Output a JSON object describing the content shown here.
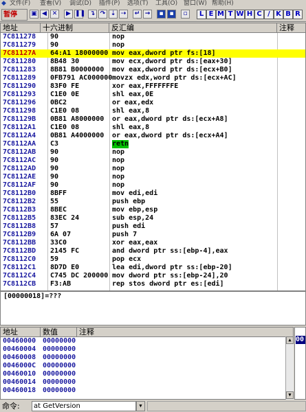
{
  "menu": [
    "文件(F)",
    "查看(V)",
    "调试(D)",
    "插件(P)",
    "选项(T)",
    "工具(O)",
    "窗口(W)",
    "帮助(H)"
  ],
  "status": "暂停",
  "toolbar": {
    "letters": [
      "L",
      "E",
      "M",
      "T",
      "W",
      "H",
      "C",
      "/",
      "K",
      "B",
      "R"
    ]
  },
  "disasm": {
    "headers": {
      "address": "地址",
      "hex": "十六进制",
      "disasm": "反汇编",
      "comment": "注释"
    },
    "rows": [
      {
        "addr": "7C811278",
        "hex": "90",
        "asm": "nop"
      },
      {
        "addr": "7C811279",
        "hex": "90",
        "asm": "nop"
      },
      {
        "addr": "7C81127A",
        "hex": "64:A1 18000000",
        "asm": "mov eax,dword ptr fs:[18]"
      },
      {
        "addr": "7C811280",
        "hex": "8B48 30",
        "asm": "mov ecx,dword ptr ds:[eax+30]"
      },
      {
        "addr": "7C811283",
        "hex": "8B81 B0000000",
        "asm": "mov eax,dword ptr ds:[ecx+B0]"
      },
      {
        "addr": "7C811289",
        "hex": "0FB791 AC000000",
        "asm": "movzx edx,word ptr ds:[ecx+AC]"
      },
      {
        "addr": "7C811290",
        "hex": "83F0 FE",
        "asm": "xor eax,FFFFFFFE"
      },
      {
        "addr": "7C811293",
        "hex": "C1E0 0E",
        "asm": "shl eax,0E"
      },
      {
        "addr": "7C811296",
        "hex": "0BC2",
        "asm": "or eax,edx"
      },
      {
        "addr": "7C811298",
        "hex": "C1E0 08",
        "asm": "shl eax,8"
      },
      {
        "addr": "7C81129B",
        "hex": "0B81 A8000000",
        "asm": "or eax,dword ptr ds:[ecx+A8]"
      },
      {
        "addr": "7C8112A1",
        "hex": "C1E0 08",
        "asm": "shl eax,8"
      },
      {
        "addr": "7C8112A4",
        "hex": "0B81 A4000000",
        "asm": "or eax,dword ptr ds:[ecx+A4]"
      },
      {
        "addr": "7C8112AA",
        "hex": "C3",
        "asm": "retn"
      },
      {
        "addr": "7C8112AB",
        "hex": "90",
        "asm": "nop"
      },
      {
        "addr": "7C8112AC",
        "hex": "90",
        "asm": "nop"
      },
      {
        "addr": "7C8112AD",
        "hex": "90",
        "asm": "nop"
      },
      {
        "addr": "7C8112AE",
        "hex": "90",
        "asm": "nop"
      },
      {
        "addr": "7C8112AF",
        "hex": "90",
        "asm": "nop"
      },
      {
        "addr": "7C8112B0",
        "hex": "8BFF",
        "asm": "mov edi,edi"
      },
      {
        "addr": "7C8112B2",
        "hex": "55",
        "asm": "push ebp"
      },
      {
        "addr": "7C8112B3",
        "hex": "8BEC",
        "asm": "mov ebp,esp"
      },
      {
        "addr": "7C8112B5",
        "hex": "83EC 24",
        "asm": "sub esp,24"
      },
      {
        "addr": "7C8112B8",
        "hex": "57",
        "asm": "push edi"
      },
      {
        "addr": "7C8112B9",
        "hex": "6A 07",
        "asm": "push 7"
      },
      {
        "addr": "7C8112BB",
        "hex": "33C0",
        "asm": "xor eax,eax"
      },
      {
        "addr": "7C8112BD",
        "hex": "2145 FC",
        "asm": "and dword ptr ss:[ebp-4],eax"
      },
      {
        "addr": "7C8112C0",
        "hex": "59",
        "asm": "pop ecx"
      },
      {
        "addr": "7C8112C1",
        "hex": "8D7D E0",
        "asm": "lea edi,dword ptr ss:[ebp-20]"
      },
      {
        "addr": "7C8112C4",
        "hex": "C745 DC 200000",
        "asm": "mov dword ptr ss:[ebp-24],20"
      },
      {
        "addr": "7C8112CB",
        "hex": "F3:AB",
        "asm": "rep stos dword ptr es:[edi]"
      }
    ]
  },
  "info": {
    "line": "[00000018]=???"
  },
  "dump": {
    "headers": {
      "address": "地址",
      "hex": "数值",
      "comment": "注释"
    },
    "rows": [
      {
        "addr": "00460000",
        "hex": "00000000"
      },
      {
        "addr": "00460004",
        "hex": "00000000"
      },
      {
        "addr": "00460008",
        "hex": "00000000"
      },
      {
        "addr": "0046000C",
        "hex": "00000000"
      },
      {
        "addr": "00460010",
        "hex": "00000000"
      },
      {
        "addr": "00460014",
        "hex": "00000000"
      },
      {
        "addr": "00460018",
        "hex": "00000000"
      }
    ]
  },
  "stack": {
    "selected": "00"
  },
  "command": {
    "label": "命令:",
    "value": "at GetVersion"
  }
}
